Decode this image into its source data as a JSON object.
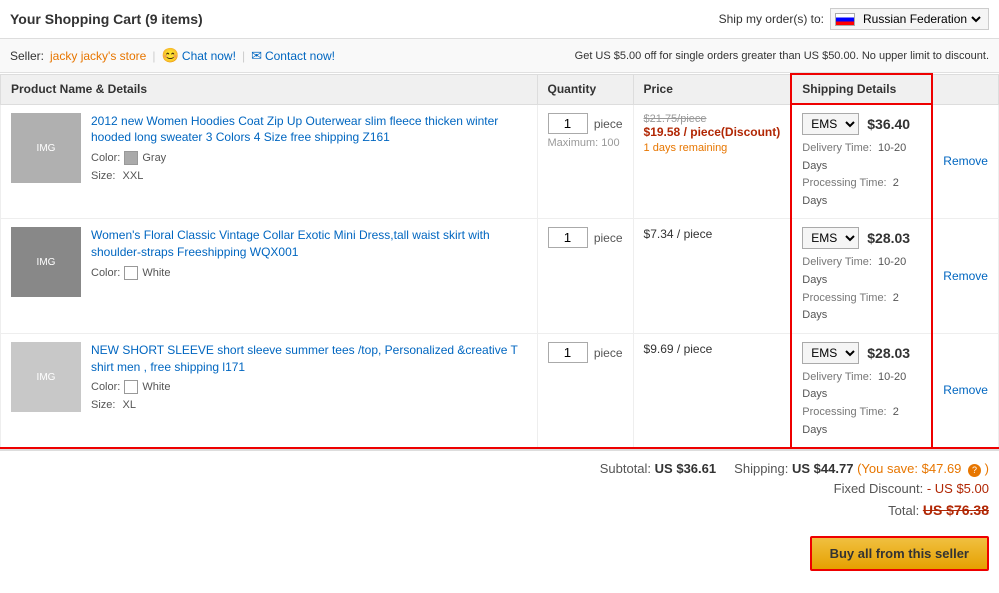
{
  "header": {
    "title": "Your Shopping Cart (9 items)",
    "ship_label": "Ship my order(s) to:",
    "country": "Russian Federation"
  },
  "seller": {
    "label": "Seller:",
    "name": "jacky jacky's store",
    "chat_label": "Chat now!",
    "contact_label": "Contact now!",
    "promo": "Get US $5.00 off for single orders greater than US $50.00. No upper limit to discount."
  },
  "table": {
    "col1": "Product Name & Details",
    "col2": "Quantity",
    "col3": "Price",
    "col4": "Shipping Details",
    "col5": ""
  },
  "products": [
    {
      "title": "2012 new Women Hoodies Coat Zip Up Outerwear slim fleece thicken winter hooded long sweater 3 Colors 4 Size free shipping Z161",
      "color_label": "Color:",
      "color": "Gray",
      "color_swatch": "#aaa",
      "size_label": "Size:",
      "size": "XXL",
      "qty": "1",
      "qty_max": "Maximum: 100",
      "qty_unit": "piece",
      "price_original": "$21.75/piece",
      "price_discount": "$19.58 / piece(Discount)",
      "price_remaining": "1 days remaining",
      "shipping_method": "EMS",
      "shipping_price": "$36.40",
      "delivery_time": "10-20 Days",
      "processing_time": "2 Days",
      "remove": "Remove",
      "img_color": "#b0b0b0"
    },
    {
      "title": "Women's Floral Classic Vintage Collar Exotic Mini Dress,tall waist skirt with shoulder-straps Freeshipping WQX001",
      "color_label": "Color:",
      "color": "White",
      "color_swatch": "#fff",
      "size_label": "",
      "size": "",
      "qty": "1",
      "qty_max": "",
      "qty_unit": "piece",
      "price_original": "",
      "price_discount": "",
      "price_regular": "$7.34 / piece",
      "price_remaining": "",
      "shipping_method": "EMS",
      "shipping_price": "$28.03",
      "delivery_time": "10-20 Days",
      "processing_time": "2 Days",
      "remove": "Remove",
      "img_color": "#888"
    },
    {
      "title": "NEW SHORT SLEEVE short sleeve summer tees /top, Personalized &creative T shirt men , free shipping l171",
      "color_label": "Color:",
      "color": "White",
      "color_swatch": "#fff",
      "size_label": "Size:",
      "size": "XL",
      "qty": "1",
      "qty_max": "",
      "qty_unit": "piece",
      "price_original": "",
      "price_discount": "",
      "price_regular": "$9.69 / piece",
      "price_remaining": "",
      "shipping_method": "EMS",
      "shipping_price": "$28.03",
      "delivery_time": "10-20 Days",
      "processing_time": "2 Days",
      "remove": "Remove",
      "img_color": "#c8c8c8"
    }
  ],
  "summary": {
    "subtotal_label": "Subtotal:",
    "subtotal_value": "US $36.61",
    "shipping_label": "Shipping:",
    "shipping_value": "US $44.77",
    "savings_text": "(You save: $47.69",
    "fixed_discount_label": "Fixed Discount:",
    "fixed_discount_value": "- US $5.00",
    "total_label": "Total:",
    "total_value": "US $76.38",
    "buy_btn": "Buy all from this seller"
  },
  "labels": {
    "delivery_time": "Delivery Time:",
    "processing_time": "Processing Time:"
  }
}
